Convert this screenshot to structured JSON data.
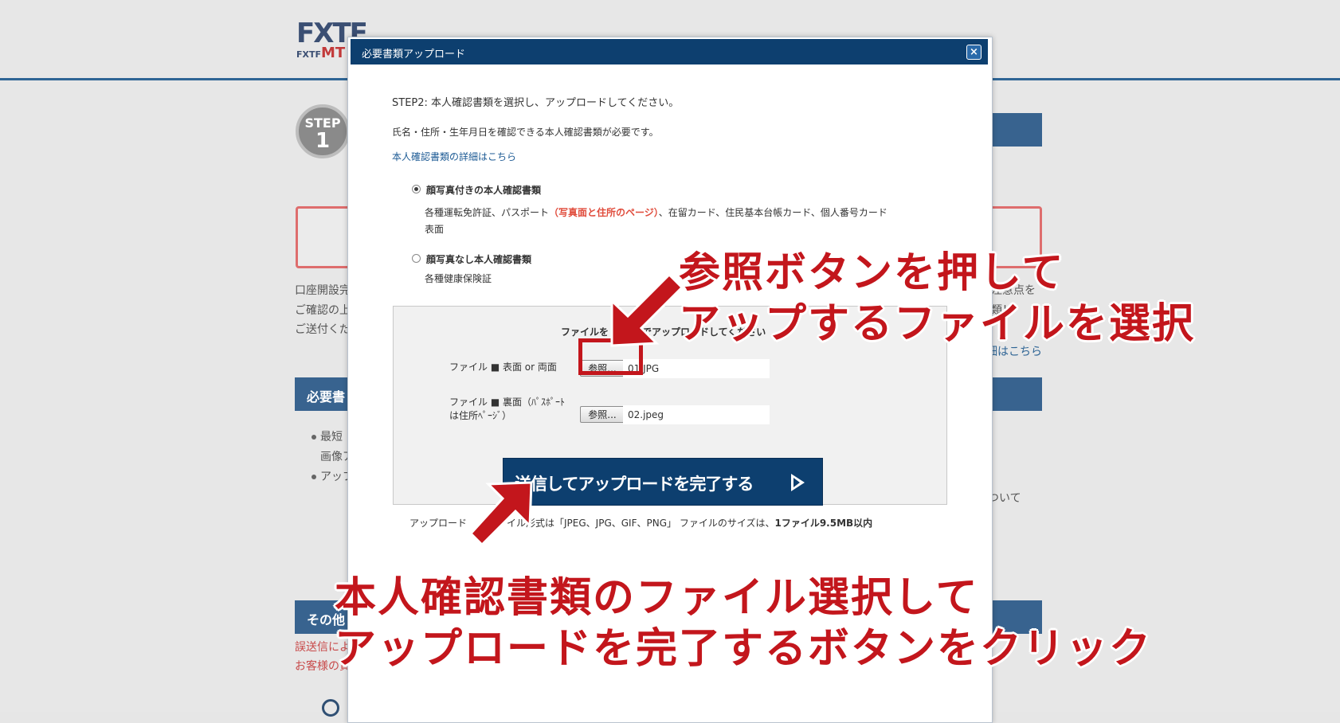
{
  "background": {
    "logo_fx": "FXTF",
    "logo_sub": "FXTF",
    "logo_mt": "MT",
    "step_label": "STEP",
    "step_number": "1",
    "left_lines": [
      "口座開設完",
      "ご確認の上",
      "ご送付くだ"
    ],
    "right_lines": [
      "注意点を",
      "類！"
    ],
    "right_link": "細はこちら",
    "section_required": "必要書",
    "bullets": [
      "最短",
      "画像ア",
      "アップ"
    ],
    "right_about": "ついて",
    "section_other": "その他",
    "red_lines": [
      "誤送信によ",
      "お客様の責"
    ]
  },
  "modal": {
    "title": "必要書類アップロード",
    "close": "×",
    "step2": "STEP2: 本人確認書類を選択し、アップロードしてください。",
    "note": "氏名・住所・生年月日を確認できる本人確認書類が必要です。",
    "details_link": "本人確認書類の詳細はこちら",
    "options": [
      {
        "title": "顔写真付きの本人確認書類",
        "desc_before": "各種運転免許証、パスポート",
        "desc_red": "（写真面と住所のページ）",
        "desc_after": "、在留カード、住民基本台帳カード、個人番号カード",
        "desc_line2": "表面",
        "selected": true
      },
      {
        "title": "顔写真なし本人確認書類",
        "desc_before": "各種健康保険証",
        "selected": false
      }
    ],
    "upload": {
      "instruction": "ファイルを",
      "instruction_tail": "でアップロードしてください",
      "file1_label": "ファイル ■ 表面 or 両面",
      "file1_value": "01.JPG",
      "file2_label_line1": "ファイル ■ 裏面（ﾊﾟｽﾎﾟｰﾄ",
      "file2_label_line2": "は住所ﾍﾟｰｼﾞ）",
      "file2_value": "02.jpeg",
      "browse": "参照...",
      "submit": "送信してアップロードを完了する"
    },
    "formats_prefix": "アップロード",
    "formats_main": "イル形式は「JPEG、JPG、GIF、PNG」 ファイルのサイズは、",
    "formats_bold": "1ファイル9.5MB以内"
  },
  "annotations": {
    "top_line1": "参照ボタンを押して",
    "top_line2": "アップするファイルを選択",
    "bottom_line1": "本人確認書類のファイル選択して",
    "bottom_line2": "アップロードを完了するボタンをクリック"
  },
  "colors": {
    "modal_header": "#0d3f6f",
    "annotation_red": "#c3161c",
    "page_bar": "#38638f"
  }
}
